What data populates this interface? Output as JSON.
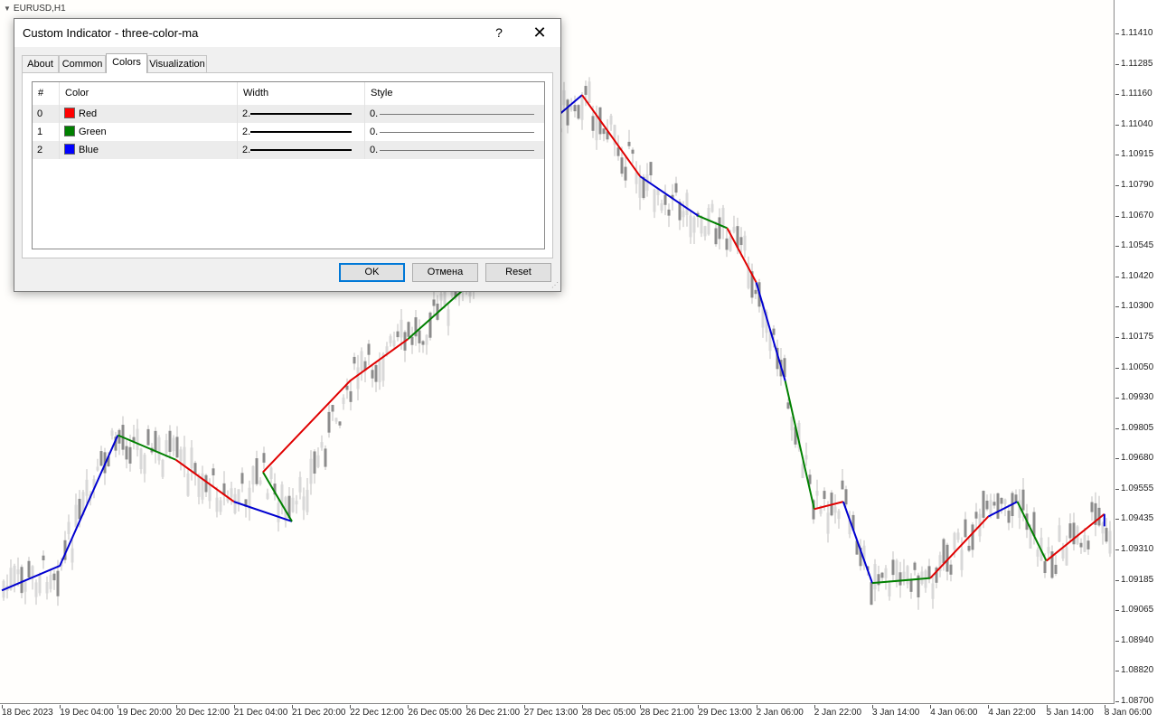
{
  "chart": {
    "symbol": "EURUSD,H1",
    "price_labels": [
      "1.11410",
      "1.11285",
      "1.11160",
      "1.11040",
      "1.10915",
      "1.10790",
      "1.10670",
      "1.10545",
      "1.10420",
      "1.10300",
      "1.10175",
      "1.10050",
      "1.09930",
      "1.09805",
      "1.09680",
      "1.09555",
      "1.09435",
      "1.09310",
      "1.09185",
      "1.09065",
      "1.08940",
      "1.08820",
      "1.08700"
    ],
    "time_labels": [
      "18 Dec 2023",
      "19 Dec 04:00",
      "19 Dec 20:00",
      "20 Dec 12:00",
      "21 Dec 04:00",
      "21 Dec 20:00",
      "22 Dec 12:00",
      "26 Dec 05:00",
      "26 Dec 21:00",
      "27 Dec 13:00",
      "28 Dec 05:00",
      "28 Dec 21:00",
      "29 Dec 13:00",
      "2 Jan 06:00",
      "2 Jan 22:00",
      "3 Jan 14:00",
      "4 Jan 06:00",
      "4 Jan 22:00",
      "5 Jan 14:00",
      "8 Jan 06:00"
    ],
    "colors": {
      "background": "#fffefc",
      "candle_fill": "#8c8c8c",
      "candle_wick": "#c0c0c0",
      "ma_red": "#e00000",
      "ma_green": "#008000",
      "ma_blue": "#0000d0"
    }
  },
  "chart_data": {
    "type": "line",
    "title": "EURUSD,H1",
    "ylim": [
      1.087,
      1.1141
    ],
    "ma_segments": [
      {
        "name": "Blue",
        "points": [
          [
            "18 Dec 2023",
            1.0915
          ],
          [
            "19 Dec 04:00",
            1.0925
          ],
          [
            "19 Dec 20:00",
            1.0978
          ]
        ]
      },
      {
        "name": "Green",
        "points": [
          [
            "19 Dec 20:00",
            1.0978
          ],
          [
            "20 Dec 12:00",
            1.0968
          ]
        ]
      },
      {
        "name": "Red",
        "points": [
          [
            "20 Dec 12:00",
            1.0968
          ],
          [
            "21 Dec 04:00",
            1.0951
          ]
        ]
      },
      {
        "name": "Blue",
        "points": [
          [
            "21 Dec 04:00",
            1.0951
          ],
          [
            "21 Dec 20:00",
            1.0943
          ]
        ]
      },
      {
        "name": "Green",
        "points": [
          [
            "21 Dec 20:00",
            1.0943
          ],
          [
            "22 Dec 04:00",
            1.0963
          ]
        ]
      },
      {
        "name": "Red",
        "points": [
          [
            "22 Dec 04:00",
            1.0963
          ],
          [
            "22 Dec 12:00",
            1.1
          ],
          [
            "26 Dec 05:00",
            1.1017
          ]
        ]
      },
      {
        "name": "Green",
        "points": [
          [
            "26 Dec 05:00",
            1.1017
          ],
          [
            "26 Dec 21:00",
            1.1038
          ]
        ]
      },
      {
        "name": "Blue",
        "points": [
          [
            "26 Dec 21:00",
            1.1038
          ],
          [
            "27 Dec 13:00",
            1.1096
          ],
          [
            "28 Dec 05:00",
            1.1116
          ]
        ]
      },
      {
        "name": "Red",
        "points": [
          [
            "28 Dec 05:00",
            1.1116
          ],
          [
            "28 Dec 21:00",
            1.1083
          ]
        ]
      },
      {
        "name": "Blue",
        "points": [
          [
            "28 Dec 21:00",
            1.1083
          ],
          [
            "29 Dec 13:00",
            1.1067
          ]
        ]
      },
      {
        "name": "Green",
        "points": [
          [
            "29 Dec 13:00",
            1.1067
          ],
          [
            "29 Dec 21:00",
            1.1062
          ]
        ]
      },
      {
        "name": "Red",
        "points": [
          [
            "29 Dec 21:00",
            1.1062
          ],
          [
            "2 Jan 06:00",
            1.104
          ]
        ]
      },
      {
        "name": "Blue",
        "points": [
          [
            "2 Jan 06:00",
            1.104
          ],
          [
            "2 Jan 14:00",
            1.1
          ]
        ]
      },
      {
        "name": "Green",
        "points": [
          [
            "2 Jan 14:00",
            1.1
          ],
          [
            "2 Jan 22:00",
            1.0948
          ]
        ]
      },
      {
        "name": "Red",
        "points": [
          [
            "2 Jan 22:00",
            1.0948
          ],
          [
            "3 Jan 06:00",
            1.0951
          ]
        ]
      },
      {
        "name": "Blue",
        "points": [
          [
            "3 Jan 06:00",
            1.0951
          ],
          [
            "3 Jan 14:00",
            1.0918
          ]
        ]
      },
      {
        "name": "Green",
        "points": [
          [
            "3 Jan 14:00",
            1.0918
          ],
          [
            "4 Jan 06:00",
            1.092
          ]
        ]
      },
      {
        "name": "Red",
        "points": [
          [
            "4 Jan 06:00",
            1.092
          ],
          [
            "4 Jan 22:00",
            1.0945
          ]
        ]
      },
      {
        "name": "Blue",
        "points": [
          [
            "4 Jan 22:00",
            1.0945
          ],
          [
            "5 Jan 06:00",
            1.0951
          ]
        ]
      },
      {
        "name": "Green",
        "points": [
          [
            "5 Jan 06:00",
            1.0951
          ],
          [
            "5 Jan 14:00",
            1.0927
          ]
        ]
      },
      {
        "name": "Red",
        "points": [
          [
            "5 Jan 14:00",
            1.0927
          ],
          [
            "8 Jan 06:00",
            1.0946
          ]
        ]
      },
      {
        "name": "Blue",
        "points": [
          [
            "8 Jan 06:00",
            1.0946
          ],
          [
            "8 Jan 06:00",
            1.0941
          ]
        ]
      }
    ]
  },
  "dialog": {
    "title": "Custom Indicator - three-color-ma",
    "help_label": "?",
    "close_label": "✕",
    "tabs": [
      {
        "label": "About",
        "active": false
      },
      {
        "label": "Common",
        "active": false
      },
      {
        "label": "Colors",
        "active": true
      },
      {
        "label": "Visualization",
        "active": false
      }
    ],
    "table": {
      "headers": [
        "#",
        "Color",
        "Width",
        "Style"
      ],
      "rows": [
        {
          "index": "0",
          "color_name": "Red",
          "color_hex": "#ff0000",
          "width": "2.",
          "style": "0."
        },
        {
          "index": "1",
          "color_name": "Green",
          "color_hex": "#008000",
          "width": "2.",
          "style": "0."
        },
        {
          "index": "2",
          "color_name": "Blue",
          "color_hex": "#0000ff",
          "width": "2.",
          "style": "0."
        }
      ]
    },
    "buttons": {
      "ok": "OK",
      "cancel": "Отмена",
      "reset": "Reset"
    }
  }
}
